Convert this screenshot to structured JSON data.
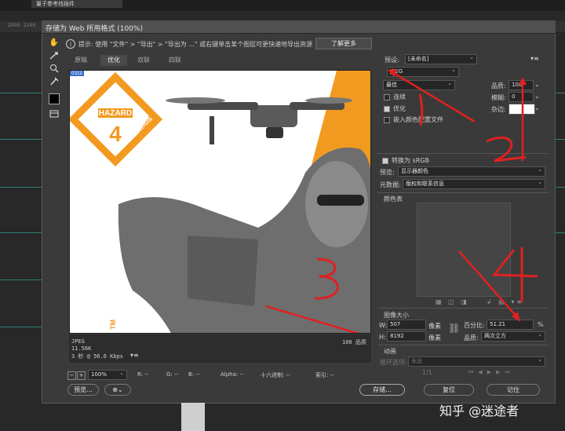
{
  "app": {
    "top_tab": "量子参考线插件",
    "ruler_marks": [
      "2000",
      "2100"
    ]
  },
  "dialog": {
    "title": "存储为 Web 所用格式 (100%)",
    "hint": "提示:  使用 \"文件\" > \"导出\" > \"导出为 ...\" 或右键单击某个图层可更快速地导出资源",
    "learn_more": "了解更多",
    "tabs": [
      "原稿",
      "优化",
      "双联",
      "四联"
    ],
    "active_tab": "优化",
    "tools": [
      "hand-tool-icon",
      "slice-select-tool-icon",
      "zoom-tool-icon",
      "eyedropper-tool-icon",
      "color-swatch",
      "toggle-slices-icon"
    ],
    "preview": {
      "label": "01t2",
      "badge_title": "HAZARD",
      "badge_number": "4",
      "badge_sub": "CALIFORNIA",
      "edge_text": "TM"
    },
    "stats": {
      "format": "JPEG",
      "size": "11.56K",
      "time": "3 秒 @ 56.6 Kbps",
      "quality_note": "100 品质"
    },
    "status_bar": {
      "zoom": "100%",
      "r": "R: --",
      "g": "G: --",
      "b": "B: --",
      "alpha": "Alpha: --",
      "hex": "十六进制: --",
      "index": "索引: --"
    },
    "buttons": {
      "preview": "预览...",
      "save": "存储...",
      "reset": "复位",
      "remember": "记住"
    },
    "settings": {
      "preset_label": "预设:",
      "preset_value": "[未命名]",
      "format_value": "JPEG",
      "compression": "最佳",
      "quality_label": "品质:",
      "quality_value": "100",
      "progressive_label": "连续",
      "progressive_checked": false,
      "blur_label": "模糊:",
      "blur_value": "0",
      "optimized_label": "优化",
      "optimized_checked": true,
      "matte_label": "杂边:",
      "embed_profile_label": "嵌入颜色配置文件",
      "embed_profile_checked": false,
      "srgb_label": "转换为 sRGB",
      "srgb_checked": true,
      "preview_label": "预览:",
      "preview_value": "显示器颜色",
      "metadata_label": "元数据:",
      "metadata_value": "版权和联系信息",
      "color_table_label": "颜色表"
    },
    "image_size": {
      "section_label": "图像大小",
      "w_label": "W:",
      "w_value": "507",
      "w_unit": "像素",
      "h_label": "H:",
      "h_value": "8192",
      "h_unit": "像素",
      "percent_label": "百分比:",
      "percent_value": "51.21",
      "percent_unit": "%",
      "quality_label": "品质:",
      "quality_value": "两次立方"
    },
    "animation": {
      "section_label": "动画",
      "loop_label": "循环选项:",
      "loop_value": "永远",
      "frame": "1/1"
    }
  },
  "annotations": [
    "1",
    "2",
    "3",
    "4"
  ],
  "watermark": "知乎 @迷途者",
  "colors": {
    "annotation": "#e02020",
    "orange": "#f29a1f"
  }
}
